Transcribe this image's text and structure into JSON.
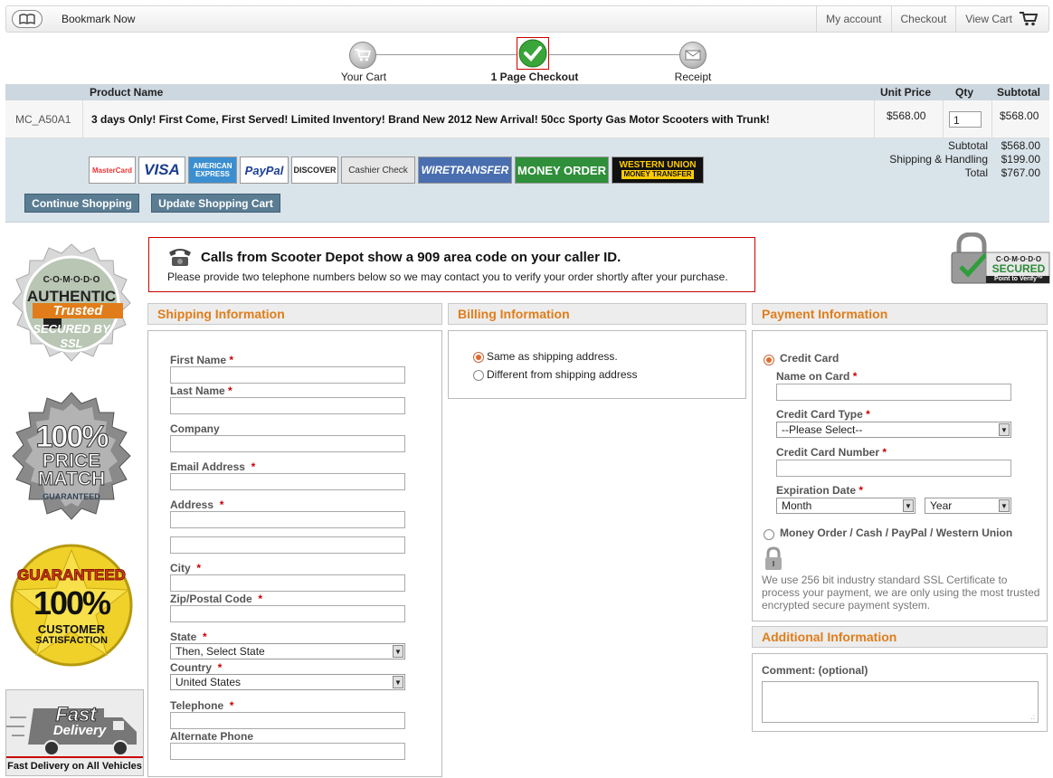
{
  "topbar": {
    "bookmark_label": "Bookmark Now",
    "links": [
      "My account",
      "Checkout",
      "View Cart"
    ]
  },
  "steps": [
    {
      "label": "Your Cart",
      "active": false
    },
    {
      "label": "1 Page Checkout",
      "active": true
    },
    {
      "label": "Receipt",
      "active": false
    }
  ],
  "cart": {
    "headers": {
      "product": "Product Name",
      "unit_price": "Unit Price",
      "qty": "Qty",
      "subtotal": "Subtotal"
    },
    "row": {
      "sku": "MC_A50A1",
      "name": "3 days Only! First Come, First Served! Limited Inventory! Brand New 2012 New Arrival! 50cc Sporty Gas Motor Scooters with Trunk!",
      "unit_price": "$568.00",
      "qty": "1",
      "subtotal": "$568.00"
    },
    "totals": [
      {
        "label": "Subtotal",
        "value": "$568.00"
      },
      {
        "label": "Shipping & Handling",
        "value": "$199.00"
      },
      {
        "label": "Total",
        "value": "$767.00"
      }
    ],
    "payment_logos": [
      "MasterCard",
      "VISA",
      "AMERICAN EXPRESS",
      "PayPal",
      "DISCOVER",
      "Cashier Check",
      "WIRETRANSFER",
      "MONEY ORDER",
      "WESTERN UNION",
      "MONEY TRANSFER"
    ],
    "buttons": {
      "continue": "Continue Shopping",
      "update": "Update Shopping Cart"
    }
  },
  "badges": {
    "ssl": [
      "C·O·M·O·D·O",
      "AUTHENTIC",
      "Trusted",
      "SECURED BY",
      "SSL"
    ],
    "price": [
      "100%",
      "PRICE",
      "MATCH",
      "GUARANTEED"
    ],
    "guaranteed": [
      "GUARANTEED",
      "100%",
      "CUSTOMER",
      "SATISFACTION"
    ],
    "fast": [
      "Fast",
      "Delivery",
      "Fast Delivery on All Vehicles"
    ],
    "comodo": [
      "C·O·M·O·D·O",
      "SECURED",
      "Point to Verify™"
    ]
  },
  "notice": {
    "title": "Calls from Scooter Depot show a 909 area code on your caller ID.",
    "text": "Please provide two telephone numbers below so we may contact you to verify your order shortly after your purchase."
  },
  "shipping": {
    "title": "Shipping Information",
    "fields": {
      "first_name": "First Name",
      "last_name": "Last Name",
      "company": "Company",
      "email": "Email Address",
      "address": "Address",
      "city": "City",
      "zip": "Zip/Postal Code",
      "state": "State",
      "country": "Country",
      "telephone": "Telephone",
      "alt_phone": "Alternate Phone"
    },
    "state_value": "Then, Select State",
    "country_value": "United States"
  },
  "billing": {
    "title": "Billing Information",
    "same": "Same as shipping address.",
    "different": "Different from shipping address"
  },
  "payment": {
    "title": "Payment Information",
    "credit_card": "Credit Card",
    "name_on_card": "Name on Card",
    "card_type": "Credit Card Type",
    "card_type_value": "--Please Select--",
    "card_number": "Credit Card Number",
    "expiration": "Expiration Date",
    "month_value": "Month",
    "year_value": "Year",
    "money_order": "Money Order / Cash / PayPal / Western Union",
    "ssl_text": "We use 256 bit industry standard SSL Certificate to process your payment, we are only using the most trusted encrypted secure payment system."
  },
  "additional": {
    "title": "Additional Information",
    "comment_label": "Comment: (optional)"
  },
  "asterisk": "*"
}
